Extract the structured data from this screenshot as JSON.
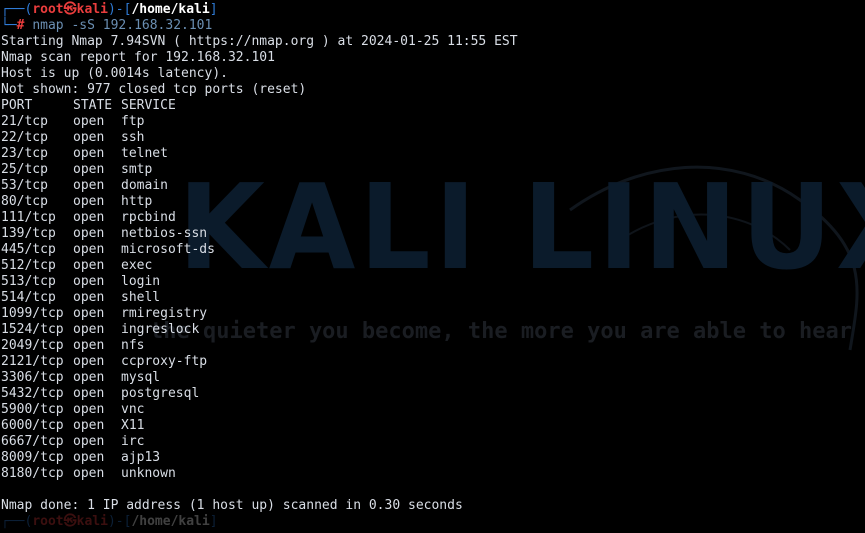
{
  "prompt": {
    "corner_top": "┌──(",
    "user": "root",
    "at_symbol": "㉿",
    "host": "kali",
    "mid": ")-[",
    "path": "/home/kali",
    "end": "]",
    "corner_bottom": "└─",
    "hash": "#",
    "command": "nmap",
    "args": "-sS 192.168.32.101"
  },
  "output": {
    "starting": "Starting Nmap 7.94SVN ( https://nmap.org ) at 2024-01-25 11:55 EST",
    "report": "Nmap scan report for 192.168.32.101",
    "host_up": "Host is up (0.0014s latency).",
    "not_shown": "Not shown: 977 closed tcp ports (reset)",
    "header": {
      "port": "PORT",
      "state": "STATE",
      "service": "SERVICE"
    },
    "ports": [
      {
        "port": "21/tcp",
        "state": "open",
        "service": "ftp"
      },
      {
        "port": "22/tcp",
        "state": "open",
        "service": "ssh"
      },
      {
        "port": "23/tcp",
        "state": "open",
        "service": "telnet"
      },
      {
        "port": "25/tcp",
        "state": "open",
        "service": "smtp"
      },
      {
        "port": "53/tcp",
        "state": "open",
        "service": "domain"
      },
      {
        "port": "80/tcp",
        "state": "open",
        "service": "http"
      },
      {
        "port": "111/tcp",
        "state": "open",
        "service": "rpcbind"
      },
      {
        "port": "139/tcp",
        "state": "open",
        "service": "netbios-ssn"
      },
      {
        "port": "445/tcp",
        "state": "open",
        "service": "microsoft-ds"
      },
      {
        "port": "512/tcp",
        "state": "open",
        "service": "exec"
      },
      {
        "port": "513/tcp",
        "state": "open",
        "service": "login"
      },
      {
        "port": "514/tcp",
        "state": "open",
        "service": "shell"
      },
      {
        "port": "1099/tcp",
        "state": "open",
        "service": "rmiregistry"
      },
      {
        "port": "1524/tcp",
        "state": "open",
        "service": "ingreslock"
      },
      {
        "port": "2049/tcp",
        "state": "open",
        "service": "nfs"
      },
      {
        "port": "2121/tcp",
        "state": "open",
        "service": "ccproxy-ftp"
      },
      {
        "port": "3306/tcp",
        "state": "open",
        "service": "mysql"
      },
      {
        "port": "5432/tcp",
        "state": "open",
        "service": "postgresql"
      },
      {
        "port": "5900/tcp",
        "state": "open",
        "service": "vnc"
      },
      {
        "port": "6000/tcp",
        "state": "open",
        "service": "X11"
      },
      {
        "port": "6667/tcp",
        "state": "open",
        "service": "irc"
      },
      {
        "port": "8009/tcp",
        "state": "open",
        "service": "ajp13"
      },
      {
        "port": "8180/tcp",
        "state": "open",
        "service": "unknown"
      }
    ],
    "done": "Nmap done: 1 IP address (1 host up) scanned in 0.30 seconds"
  },
  "wallpaper": {
    "title": "KALI LINUX",
    "tagline": "the quieter you become, the more you are able to hear"
  },
  "colors": {
    "background": "#000000",
    "prompt_blue": "#2f7bd6",
    "prompt_red": "#ea3d3d",
    "text": "#d9dee6"
  }
}
